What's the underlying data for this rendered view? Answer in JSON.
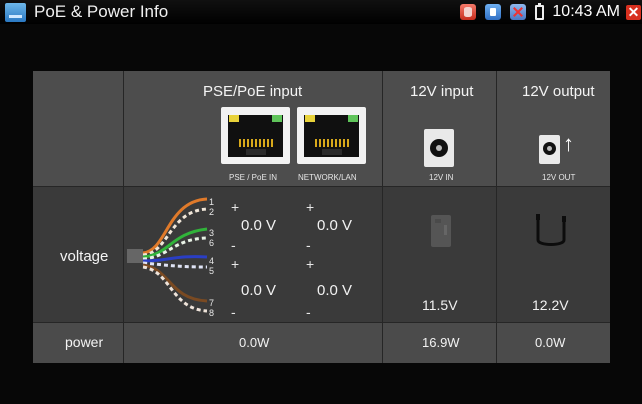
{
  "statusbar": {
    "title": "PoE & Power Info",
    "time": "10:43 AM",
    "icons": [
      "database-icon",
      "info-icon",
      "usb-icon",
      "battery-icon",
      "close-icon"
    ]
  },
  "table": {
    "headers": {
      "poe": "PSE/PoE input",
      "in12": "12V input",
      "out12": "12V output"
    },
    "port_labels": {
      "pse": "PSE / PoE IN",
      "lan": "NETWORK/LAN",
      "in12": "12V IN",
      "out12": "12V OUT"
    },
    "rows": {
      "voltage": "voltage",
      "power": "power"
    },
    "pins": [
      "1",
      "2",
      "3",
      "6",
      "4",
      "5",
      "7",
      "8"
    ],
    "signs": {
      "plus": "+",
      "minus": "-"
    },
    "poe_voltages": [
      "0.0 V",
      "0.0 V",
      "0.0 V",
      "0.0 V"
    ],
    "in12_voltage": "11.5V",
    "out12_voltage": "12.2V",
    "poe_power": "0.0W",
    "in12_power": "16.9W",
    "out12_power": "0.0W"
  },
  "colors": {
    "accent_red": "#d8301f",
    "led_yellow": "#e8d23a",
    "led_green": "#5fc45a"
  }
}
